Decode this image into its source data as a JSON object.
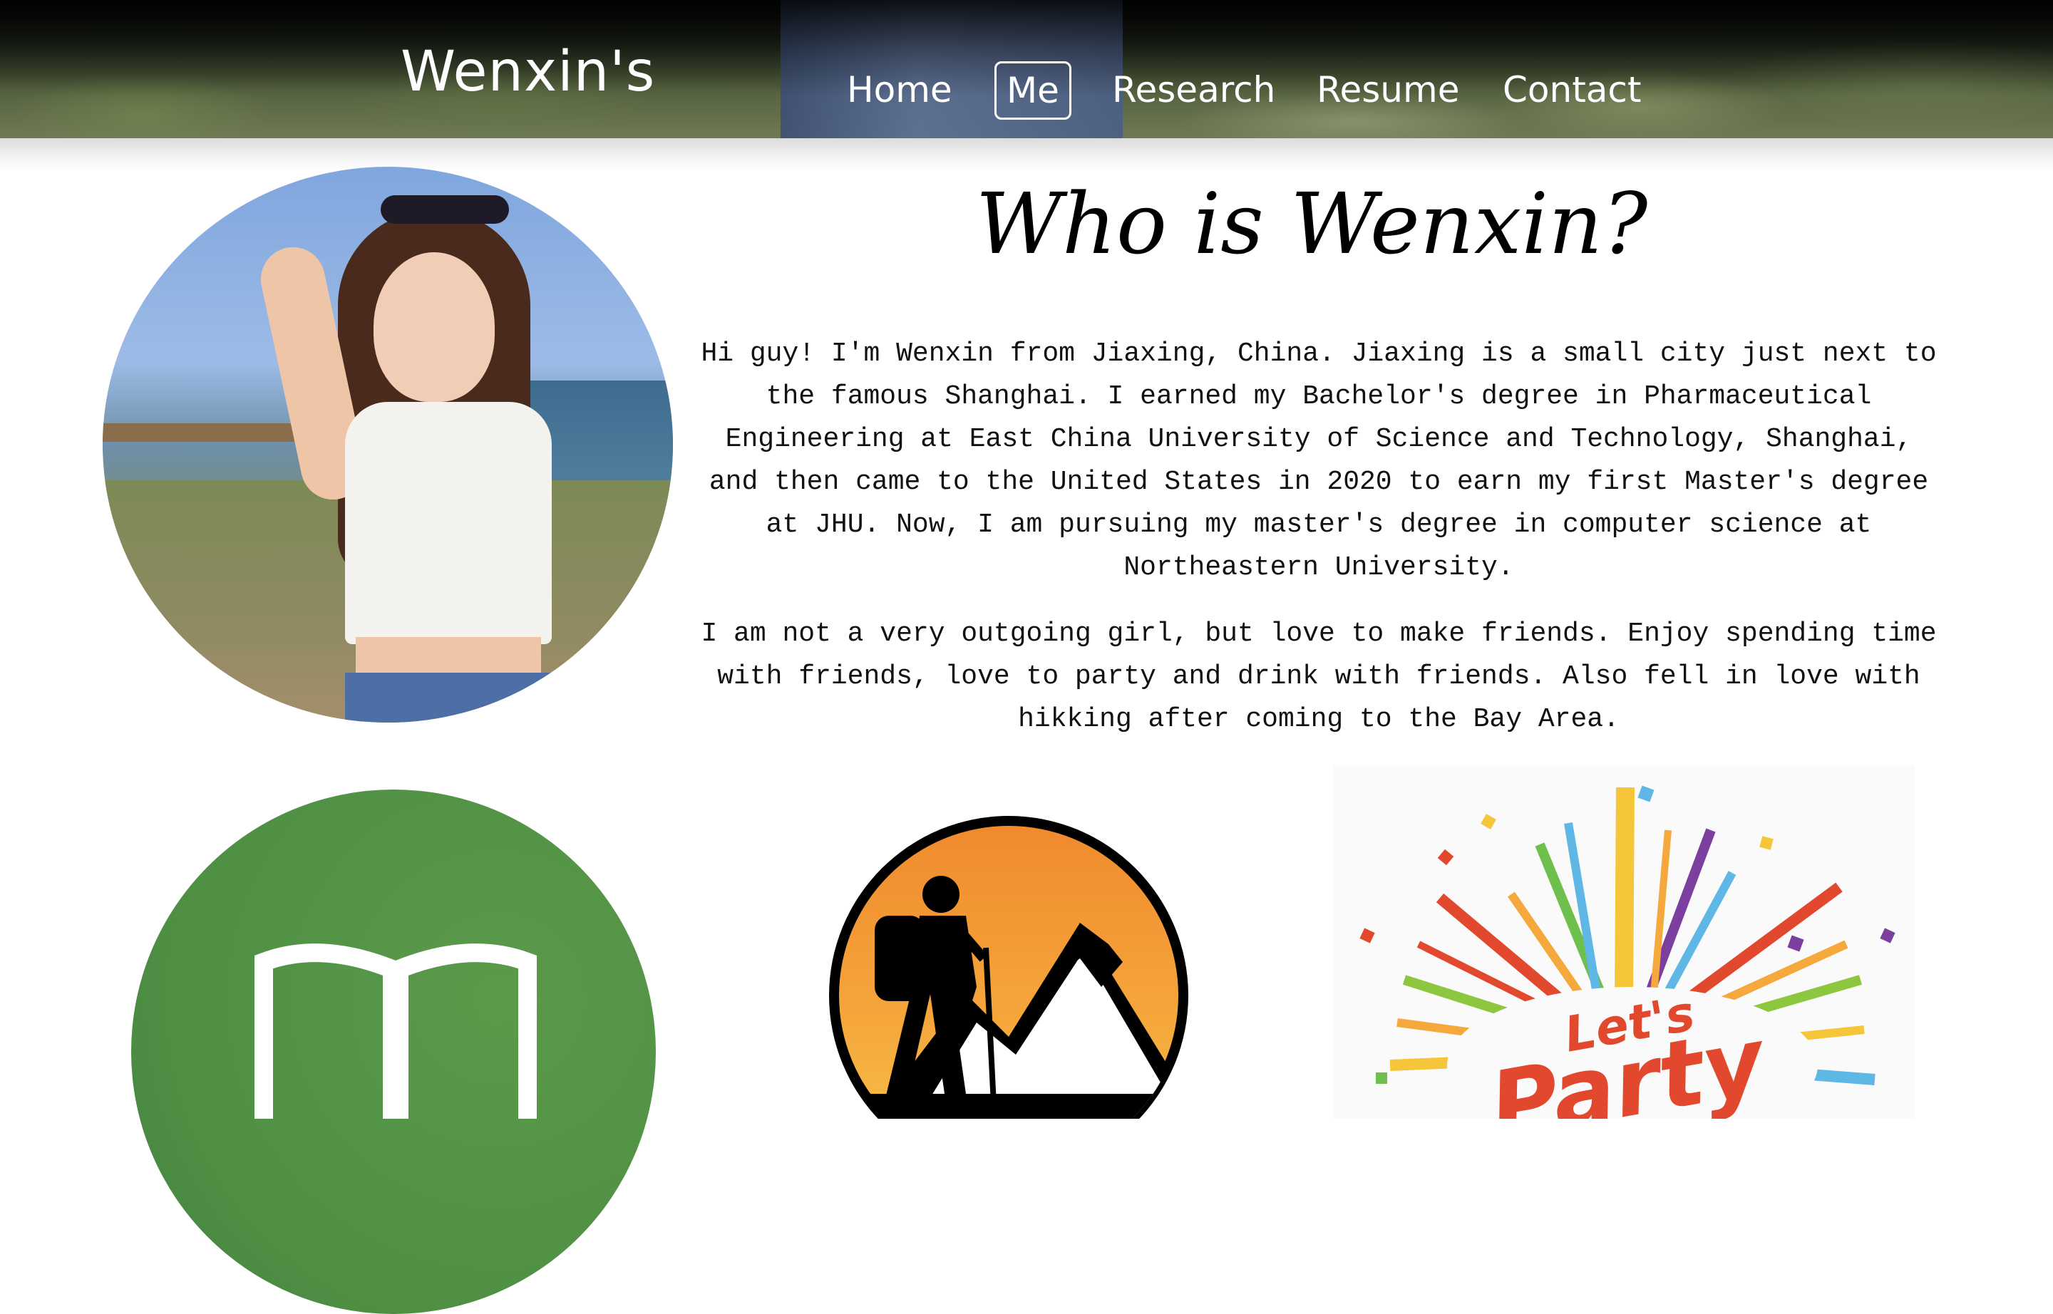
{
  "nav": {
    "brand": "Wenxin's",
    "items": [
      {
        "label": "Home",
        "active": false
      },
      {
        "label": "Me",
        "active": true
      },
      {
        "label": "Research",
        "active": false
      },
      {
        "label": "Resume",
        "active": false
      },
      {
        "label": "Contact",
        "active": false
      }
    ]
  },
  "main": {
    "heading": "Who is Wenxin?",
    "paragraphs": [
      "Hi guy! I'm Wenxin from Jiaxing, China. Jiaxing is a small city just next to the famous Shanghai. I earned my Bachelor's degree in Pharmaceutical Engineering at East China University of Science and Technology, Shanghai, and then came to the United States in 2020 to earn my first Master's degree at JHU. Now, I am pursuing my master's degree in computer science at Northeastern University.",
      "I am not a very outgoing girl, but love to make friends. Enjoy spending time with friends, love to party and drink with friends. Also fell in love with hikking after coming to the Bay Area."
    ]
  },
  "hobbies": {
    "reading_icon": "open-book-icon",
    "hiking_icon": "hiker-mountain-icon",
    "party_icon": "lets-party-icon",
    "party_text_1": "Let's",
    "party_text_2": "Party"
  },
  "colors": {
    "nav_text": "#ffffff",
    "book_green": "#4e8f44",
    "hike_orange": "#f08a2e",
    "party_red": "#e2482d"
  }
}
